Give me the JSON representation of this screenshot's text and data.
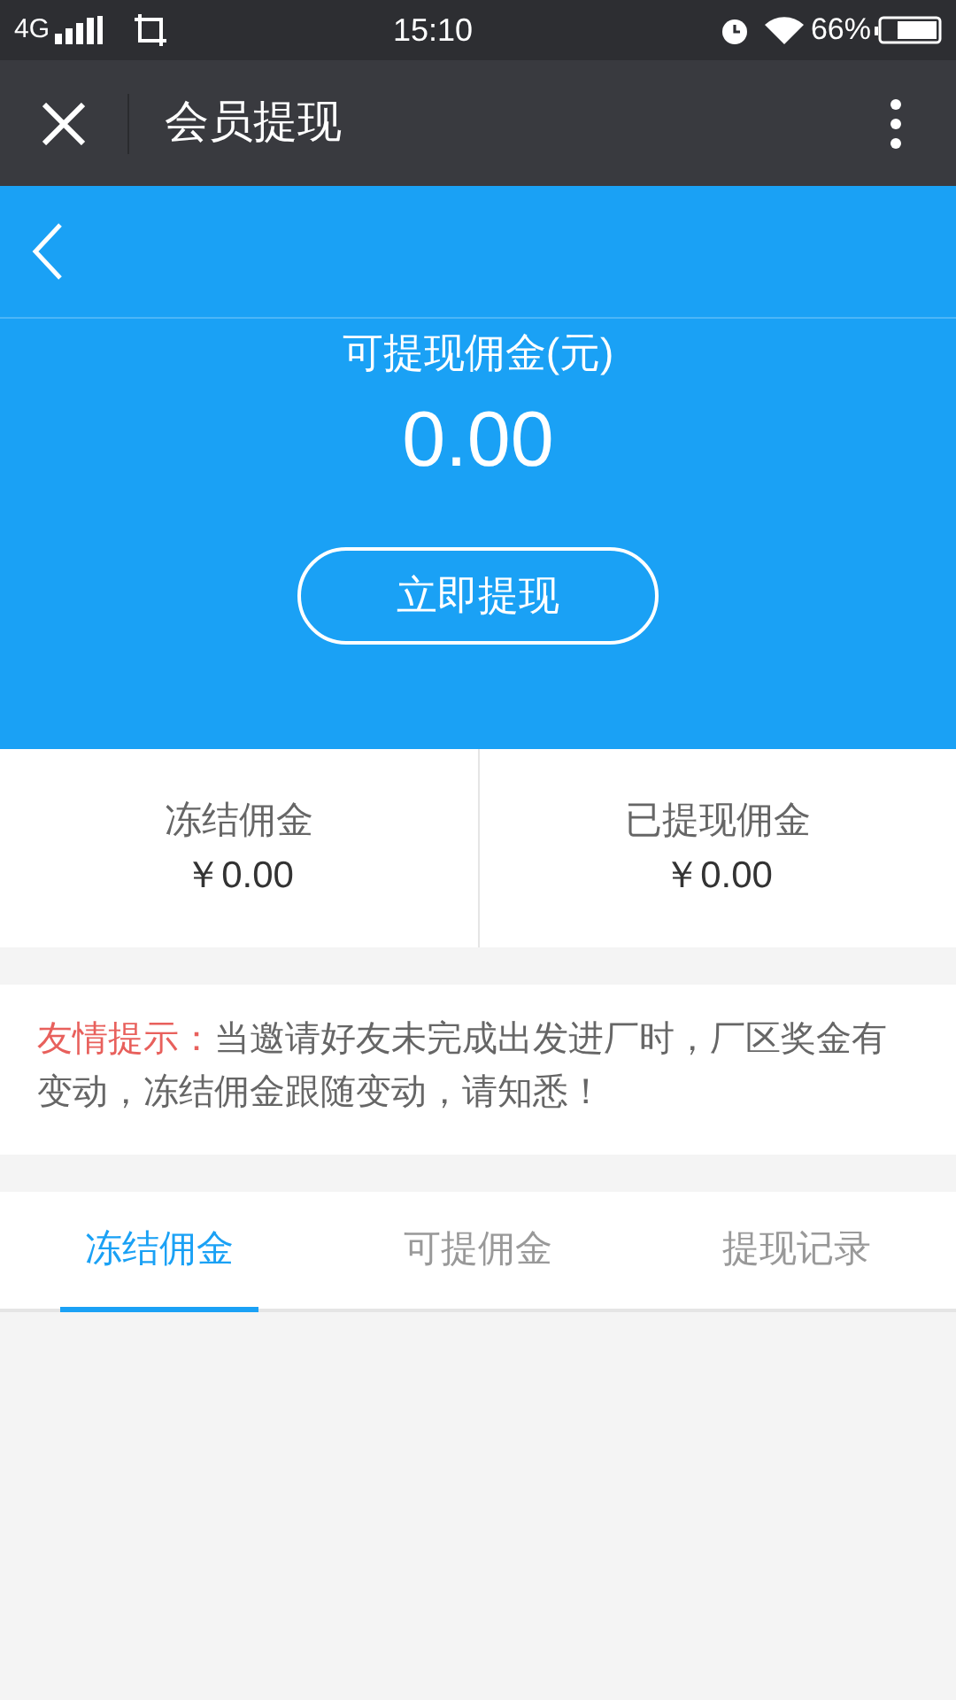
{
  "status_bar": {
    "network": "4G",
    "time": "15:10",
    "battery": "66%"
  },
  "title_bar": {
    "title": "会员提现"
  },
  "balance": {
    "label": "可提现佣金(元)",
    "amount": "0.00",
    "button": "立即提现"
  },
  "summary": [
    {
      "label": "冻结佣金",
      "amount": "￥0.00"
    },
    {
      "label": "已提现佣金",
      "amount": "￥0.00"
    }
  ],
  "notice": {
    "label": "友情提示：",
    "text": "当邀请好友未完成出发进厂时，厂区奖金有变动，冻结佣金跟随变动，请知悉！"
  },
  "tabs": [
    {
      "label": "冻结佣金",
      "selected": true
    },
    {
      "label": "可提佣金",
      "selected": false
    },
    {
      "label": "提现记录",
      "selected": false
    }
  ]
}
